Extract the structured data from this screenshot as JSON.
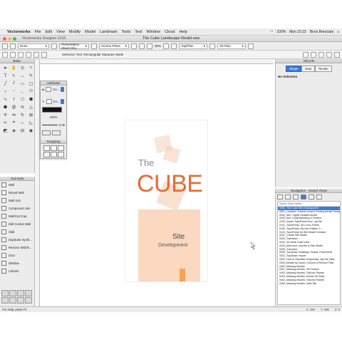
{
  "menubar": {
    "app": "Vectorworks",
    "items": [
      "File",
      "Edit",
      "View",
      "Modify",
      "Model",
      "Landmark",
      "Tools",
      "Text",
      "Window",
      "Cloud",
      "Help"
    ],
    "battery": "100%",
    "clock": "Mon 15:15",
    "user": "Boris Bresciani"
  },
  "window": {
    "app_tab": "Vectorworks Designer 2016",
    "doc_title": "The Cube Landscape Model.vwx"
  },
  "toolbar": {
    "class_dropdown": "None",
    "view_dropdown": "Presentation Sheet Sho...",
    "plane_dropdown": "Screen Plane",
    "zoom": "30%",
    "top_plan": "Top/Plan",
    "render": "2D Plan",
    "mode_text": "Selection Tool: Rectangular Marquee Mode"
  },
  "palettes": {
    "basic_title": "Basic",
    "attributes_title": "Attributes",
    "attributes_fill_label": "Co...",
    "attributes_pen_label": "Co...",
    "opacity": "100%",
    "line_weight": "0.05",
    "snapping_title": "Snapping",
    "toolsets_title": "Tool Sets",
    "obj_info_title": "Obj Info",
    "obj_info_tabs": [
      "Shape",
      "Data",
      "Render"
    ],
    "obj_info_active_tab": "Shape",
    "no_selection": "No Selection",
    "navigation_title": "Navigation - Saved Views",
    "nav_column": "Saved View Name"
  },
  "toolsets": [
    {
      "label": "Wall",
      "icon": "wall-icon"
    },
    {
      "label": "Round Wall",
      "icon": "round-wall-icon"
    },
    {
      "label": "Wall Join",
      "icon": "wall-join-icon"
    },
    {
      "label": "Component Join",
      "icon": "component-join-icon"
    },
    {
      "label": "Wall End Cap",
      "icon": "wall-end-cap-icon"
    },
    {
      "label": "Edit Curtain Wall",
      "icon": "curtain-wall-icon"
    },
    {
      "label": "Slab",
      "icon": "slab-icon"
    },
    {
      "label": "Duplicate Symb...",
      "icon": "duplicate-symbol-icon"
    },
    {
      "label": "Remove Wall B...",
      "icon": "remove-wall-break-icon"
    },
    {
      "label": "Door",
      "icon": "door-icon"
    },
    {
      "label": "Window",
      "icon": "window-icon"
    },
    {
      "label": "Column",
      "icon": "column-icon"
    }
  ],
  "saved_views": [
    "0000_The Cube Site Development",
    "0001_Location: Central London Printing Aerial Photograp",
    "0002_Aim: Highly Detailed Model",
    "0003_Aim: Understanding of Context",
    "0100_Import TopoPoints from .xyz file",
    "0101_TopoPoints: 3D Locus Points",
    "0102_TopoPoints Obj Info Palette: 3 ...",
    "0103_TopoPoints for Site Model Creation",
    "0201_Create Site Model",
    "0202_Transition",
    "0203_3D Mesh Solid View",
    "0204_Add more: any file to Site Model",
    "0205_Transition",
    "0300_TopoData: Buildings, Roads, Pavements",
    "0301_TopoData: Import",
    "0302_How to Visualise Graphically .shp file Data",
    "0303_Modify by record: Column of Record Field",
    "0400_Massing Models",
    "0401_Massing Models: 3D Feature",
    "0402_Massing Models: Obj Info Palette",
    "0403_Massing Models: Extract 3D Data",
    "0404_Massing Models: Obj Info Palette",
    "0405_Massing Models: Data Tab"
  ],
  "status": {
    "left": "For Help, press F1",
    "x": "X: 105",
    "y": "Y: 185",
    "z": "Z: 0"
  },
  "cover": {
    "the": "The",
    "cube": "CUBE",
    "site": "Site",
    "development": "Development"
  },
  "colors": {
    "accent": "#3a7ad9",
    "cube_orange": "#e76b35",
    "peach": "#fbd8c0"
  }
}
